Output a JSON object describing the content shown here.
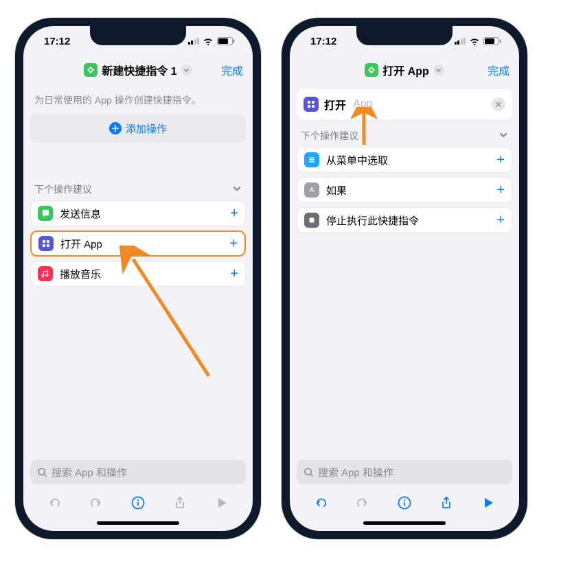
{
  "status": {
    "time": "17:12"
  },
  "nav": {
    "left_title": "新建快捷指令 1",
    "right_title": "打开 App",
    "done": "完成"
  },
  "left": {
    "hint": "为日常使用的 App 操作创建快捷指令。",
    "add_action": "添加操作",
    "section": "下个操作建议",
    "rows": [
      {
        "label": "发送信息",
        "color": "#34c759",
        "icon": "chat"
      },
      {
        "label": "打开 App",
        "color": "#5856d6",
        "icon": "grid",
        "highlight": true
      },
      {
        "label": "播放音乐",
        "color": "#fc3158",
        "icon": "music"
      }
    ]
  },
  "right": {
    "action": {
      "verb": "打开",
      "param": "App"
    },
    "section": "下个操作建议",
    "rows": [
      {
        "label": "从菜单中选取",
        "color": "#1fa7ff",
        "icon": "menu"
      },
      {
        "label": "如果",
        "color": "#9f9fa5",
        "icon": "branch"
      },
      {
        "label": "停止执行此快捷指令",
        "color": "#6d6d72",
        "icon": "stop"
      }
    ]
  },
  "search": {
    "placeholder": "搜索 App 和操作"
  }
}
